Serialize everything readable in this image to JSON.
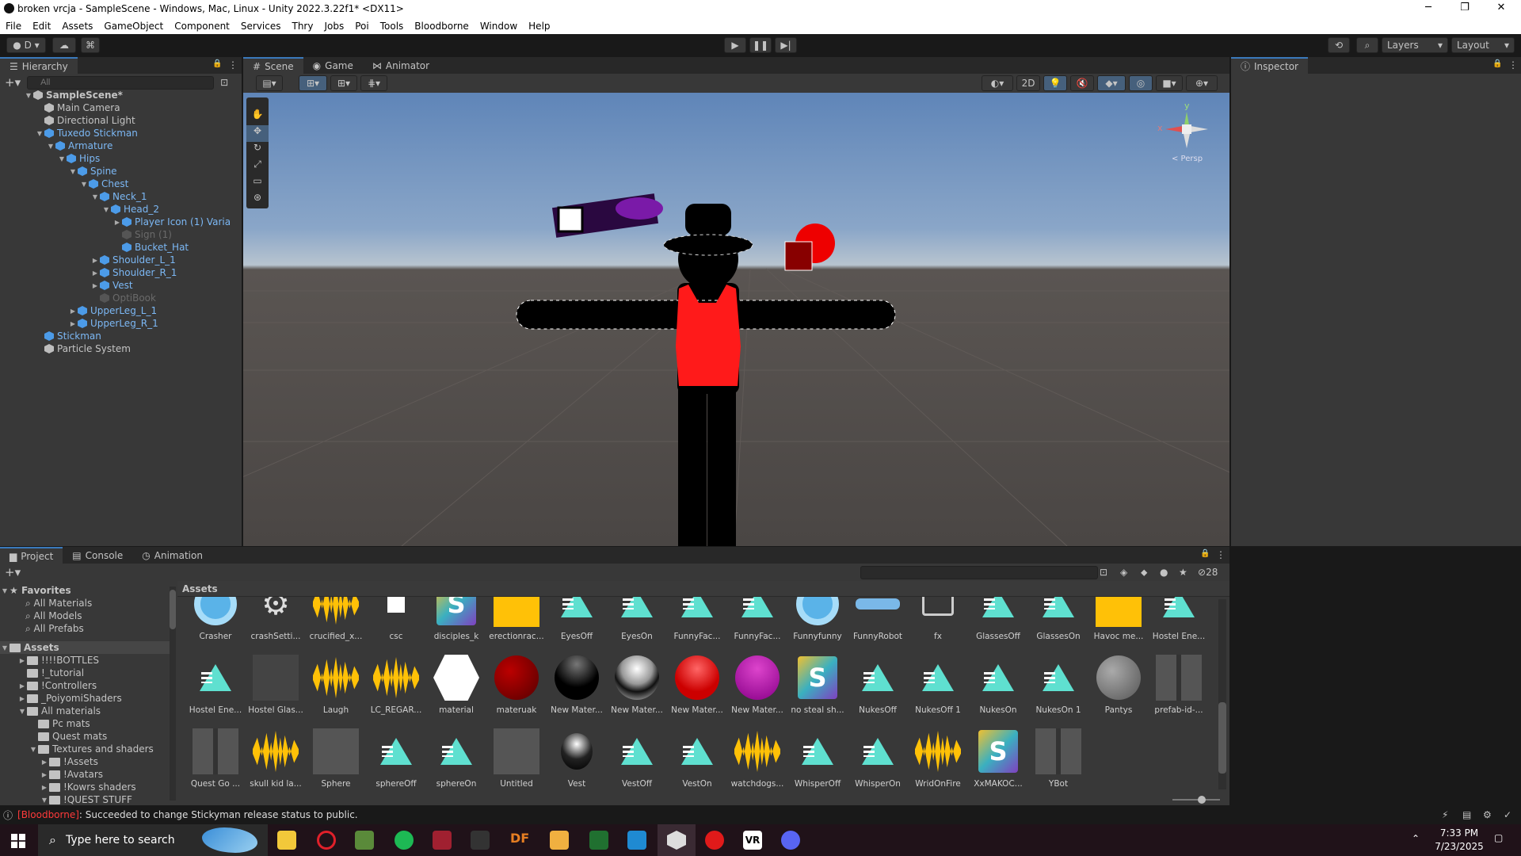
{
  "window": {
    "title": "broken vrcja - SampleScene - Windows, Mac, Linux - Unity 2022.3.22f1* <DX11>"
  },
  "menu": [
    "File",
    "Edit",
    "Assets",
    "GameObject",
    "Component",
    "Services",
    "Thry",
    "Jobs",
    "Poi",
    "Tools",
    "Bloodborne",
    "Window",
    "Help"
  ],
  "toolbar": {
    "account": "D",
    "layers": "Layers",
    "layout": "Layout"
  },
  "hierarchy": {
    "tab": "Hierarchy",
    "search_placeholder": "All",
    "items": [
      {
        "label": "SampleScene*",
        "depth": 0,
        "arrow": "▼",
        "style": "scene"
      },
      {
        "label": "Main Camera",
        "depth": 1,
        "arrow": "",
        "style": "normal"
      },
      {
        "label": "Directional Light",
        "depth": 1,
        "arrow": "",
        "style": "normal"
      },
      {
        "label": "Tuxedo Stickman",
        "depth": 1,
        "arrow": "▼",
        "style": "blue"
      },
      {
        "label": "Armature",
        "depth": 2,
        "arrow": "▼",
        "style": "blue"
      },
      {
        "label": "Hips",
        "depth": 3,
        "arrow": "▼",
        "style": "blue"
      },
      {
        "label": "Spine",
        "depth": 4,
        "arrow": "▼",
        "style": "blue"
      },
      {
        "label": "Chest",
        "depth": 5,
        "arrow": "▼",
        "style": "blue"
      },
      {
        "label": "Neck_1",
        "depth": 6,
        "arrow": "▼",
        "style": "blue"
      },
      {
        "label": "Head_2",
        "depth": 7,
        "arrow": "▼",
        "style": "blue"
      },
      {
        "label": "Player Icon (1) Varia",
        "depth": 8,
        "arrow": "▶",
        "style": "blue"
      },
      {
        "label": "Sign (1)",
        "depth": 8,
        "arrow": "",
        "style": "dim"
      },
      {
        "label": "Bucket_Hat",
        "depth": 8,
        "arrow": "",
        "style": "blue"
      },
      {
        "label": "Shoulder_L_1",
        "depth": 6,
        "arrow": "▶",
        "style": "blue"
      },
      {
        "label": "Shoulder_R_1",
        "depth": 6,
        "arrow": "▶",
        "style": "blue"
      },
      {
        "label": "Vest",
        "depth": 6,
        "arrow": "▶",
        "style": "blue"
      },
      {
        "label": "OptiBook",
        "depth": 6,
        "arrow": "",
        "style": "dim"
      },
      {
        "label": "UpperLeg_L_1",
        "depth": 4,
        "arrow": "▶",
        "style": "blue"
      },
      {
        "label": "UpperLeg_R_1",
        "depth": 4,
        "arrow": "▶",
        "style": "blue"
      },
      {
        "label": "Stickman",
        "depth": 1,
        "arrow": "",
        "style": "blue"
      },
      {
        "label": "Particle System",
        "depth": 1,
        "arrow": "",
        "style": "normal"
      }
    ]
  },
  "scene": {
    "tabs": [
      "Scene",
      "Game",
      "Animator"
    ],
    "mode_2d": "2D",
    "persp": "< Persp",
    "gizmo_x": "x",
    "gizmo_y": "y"
  },
  "inspector": {
    "tab": "Inspector"
  },
  "project": {
    "tabs": [
      "Project",
      "Console",
      "Animation"
    ],
    "breadcrumb": "Assets",
    "hidden_count": "28",
    "favorites_header": "Favorites",
    "favorites": [
      "All Materials",
      "All Models",
      "All Prefabs"
    ],
    "assets_header": "Assets",
    "tree": [
      {
        "label": "!!!!BOTTLES",
        "depth": 1,
        "arrow": "▶"
      },
      {
        "label": "!_tutorial",
        "depth": 1,
        "arrow": ""
      },
      {
        "label": "!Controllers",
        "depth": 1,
        "arrow": "▶"
      },
      {
        "label": "_PoiyomiShaders",
        "depth": 1,
        "arrow": "▶"
      },
      {
        "label": "All materials",
        "depth": 1,
        "arrow": "▼"
      },
      {
        "label": "Pc mats",
        "depth": 2,
        "arrow": ""
      },
      {
        "label": "Quest mats",
        "depth": 2,
        "arrow": ""
      },
      {
        "label": "Textures and shaders",
        "depth": 2,
        "arrow": "▼"
      },
      {
        "label": "!Assets",
        "depth": 3,
        "arrow": "▶"
      },
      {
        "label": "!Avatars",
        "depth": 3,
        "arrow": "▶"
      },
      {
        "label": "!Kowrs shaders",
        "depth": 3,
        "arrow": "▶"
      },
      {
        "label": "!QUEST STUFF",
        "depth": 3,
        "arrow": "▼"
      }
    ],
    "assets": [
      {
        "label": "Crasher",
        "kind": "circle"
      },
      {
        "label": "crashSetti...",
        "kind": "gear"
      },
      {
        "label": "crucified_x...",
        "kind": "wave"
      },
      {
        "label": "csc",
        "kind": "white-square"
      },
      {
        "label": "disciples_k",
        "kind": "s-logo"
      },
      {
        "label": "erectionrac...",
        "kind": "yellow"
      },
      {
        "label": "EyesOff",
        "kind": "tri"
      },
      {
        "label": "EyesOn",
        "kind": "tri"
      },
      {
        "label": "FunnyFac...",
        "kind": "tri"
      },
      {
        "label": "FunnyFac...",
        "kind": "tri"
      },
      {
        "label": "Funnyfunny",
        "kind": "circle"
      },
      {
        "label": "FunnyRobot",
        "kind": "robot"
      },
      {
        "label": "fx",
        "kind": "fx"
      },
      {
        "label": "GlassesOff",
        "kind": "tri"
      },
      {
        "label": "GlassesOn",
        "kind": "tri"
      },
      {
        "label": "Havoc me...",
        "kind": "yellow"
      },
      {
        "label": "Hostel Ene...",
        "kind": "tri"
      },
      {
        "label": "Hostel Ene...",
        "kind": "tri"
      },
      {
        "label": "Hostel Glas...",
        "kind": "dark-model"
      },
      {
        "label": "Laugh",
        "kind": "wave"
      },
      {
        "label": "LC_REGAR...",
        "kind": "wave"
      },
      {
        "label": "material",
        "kind": "white-hex"
      },
      {
        "label": "materuak",
        "kind": "sphere-darkred"
      },
      {
        "label": "New Mater...",
        "kind": "sphere-black"
      },
      {
        "label": "New Mater...",
        "kind": "sphere-chrome"
      },
      {
        "label": "New Mater...",
        "kind": "sphere-red"
      },
      {
        "label": "New Mater...",
        "kind": "sphere-purple"
      },
      {
        "label": "no steal sh...",
        "kind": "s-logo"
      },
      {
        "label": "NukesOff",
        "kind": "tri"
      },
      {
        "label": "NukesOff 1",
        "kind": "tri"
      },
      {
        "label": "NukesOn",
        "kind": "tri"
      },
      {
        "label": "NukesOn 1",
        "kind": "tri"
      },
      {
        "label": "Pantys",
        "kind": "sphere-grey"
      },
      {
        "label": "prefab-id-...",
        "kind": "figure"
      },
      {
        "label": "Quest Go ...",
        "kind": "figure"
      },
      {
        "label": "skull kid la...",
        "kind": "wave"
      },
      {
        "label": "Sphere",
        "kind": "grey-box"
      },
      {
        "label": "sphereOff",
        "kind": "tri"
      },
      {
        "label": "sphereOn",
        "kind": "tri"
      },
      {
        "label": "Untitled",
        "kind": "scribble"
      },
      {
        "label": "Vest",
        "kind": "helmet"
      },
      {
        "label": "VestOff",
        "kind": "tri"
      },
      {
        "label": "VestOn",
        "kind": "tri"
      },
      {
        "label": "watchdogs...",
        "kind": "wave"
      },
      {
        "label": "WhisperOff",
        "kind": "tri"
      },
      {
        "label": "WhisperOn",
        "kind": "tri"
      },
      {
        "label": "WridOnFire",
        "kind": "wave"
      },
      {
        "label": "XxMAKOC...",
        "kind": "s-logo"
      },
      {
        "label": "YBot",
        "kind": "figure"
      }
    ]
  },
  "status": {
    "prefix": "[Bloodborne]",
    "message": ": Succeeded to change Stickyman release status to public."
  },
  "taskbar": {
    "search_placeholder": "Type here to search",
    "time": "7:33 PM",
    "date": "7/23/2025"
  },
  "colors": {
    "accent": "#3a79bb",
    "triangle": "#5fe0d0",
    "audio": "#ffc107",
    "statusRed": "#ff3a3a"
  }
}
